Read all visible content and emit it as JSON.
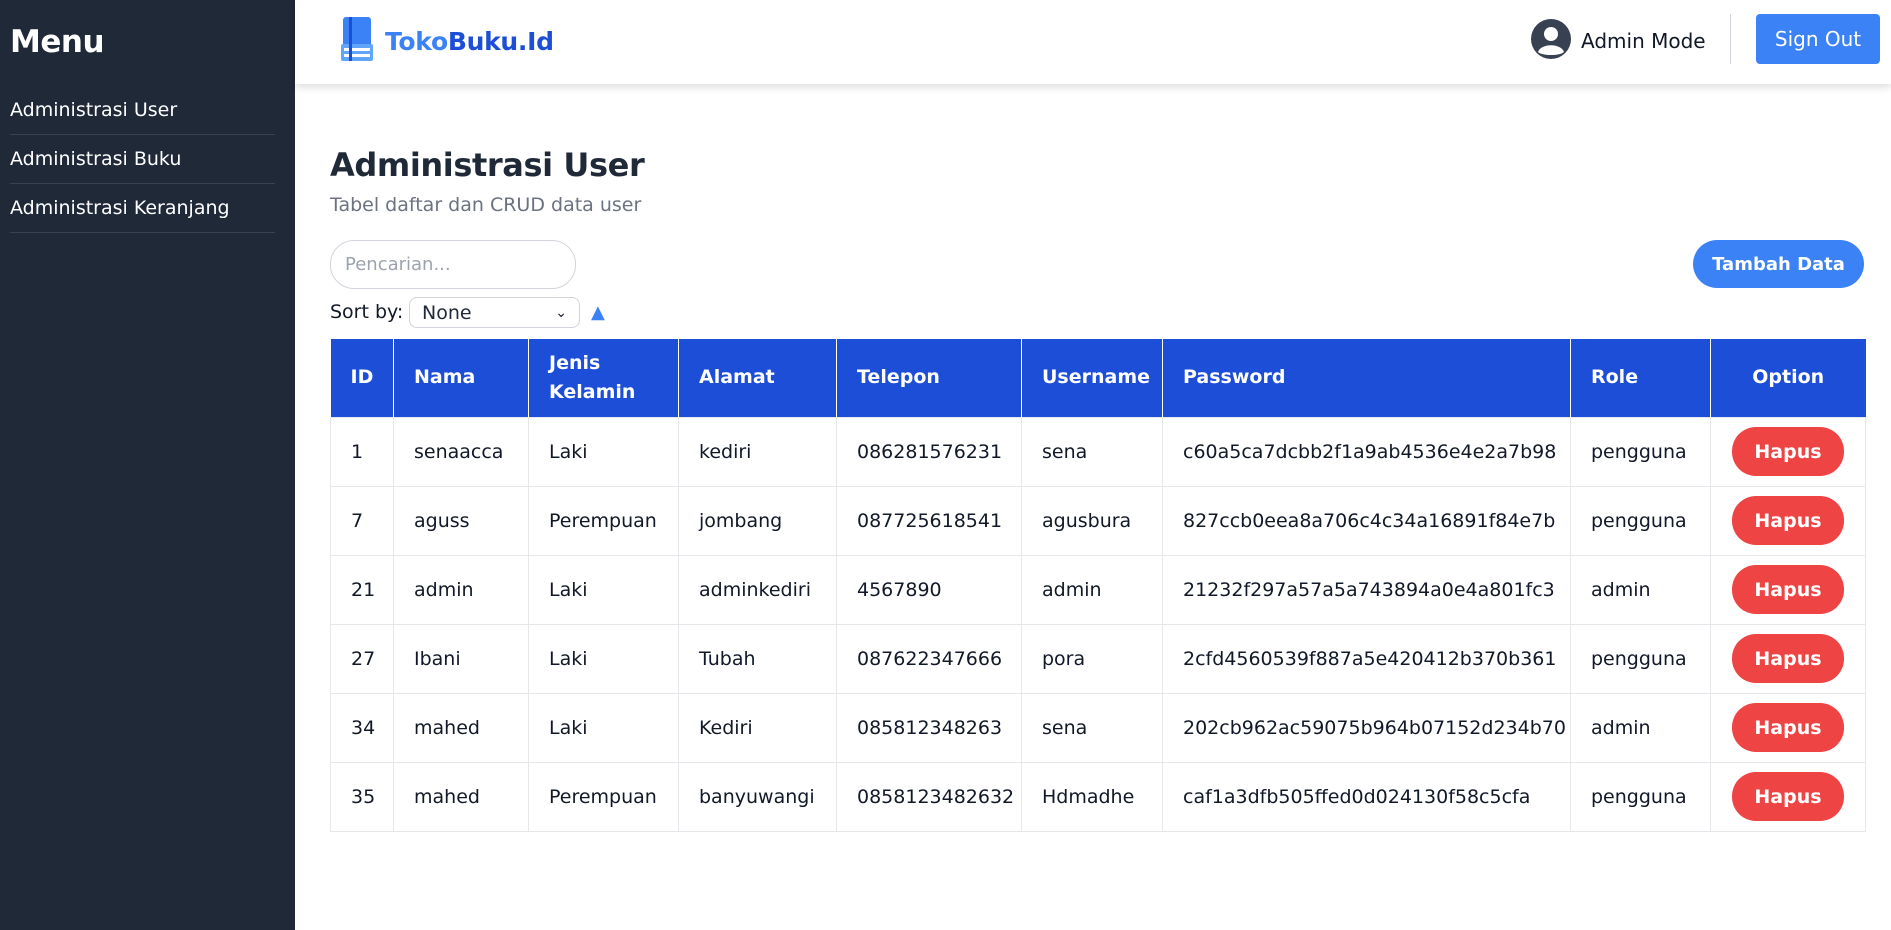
{
  "sidebar": {
    "title": "Menu",
    "items": [
      {
        "label": "Administrasi User"
      },
      {
        "label": "Administrasi Buku"
      },
      {
        "label": "Administrasi Keranjang"
      }
    ]
  },
  "header": {
    "brand_part1": "Toko",
    "brand_part2": "Buku.Id",
    "admin_mode": "Admin Mode",
    "sign_out": "Sign Out"
  },
  "main": {
    "title": "Administrasi User",
    "subtitle": "Tabel daftar dan CRUD data user",
    "search_placeholder": "Pencarian...",
    "add_button": "Tambah Data",
    "sort_label": "Sort by:",
    "sort_value": "None",
    "sort_direction_icon": "▲"
  },
  "table": {
    "headers": [
      "ID",
      "Nama",
      "Jenis Kelamin",
      "Alamat",
      "Telepon",
      "Username",
      "Password",
      "Role",
      "Option"
    ],
    "rows": [
      [
        "1",
        "senaacca",
        "Laki",
        "kediri",
        "086281576231",
        "sena",
        "c60a5ca7dcbb2f1a9ab4536e4e2a7b98",
        "pengguna"
      ],
      [
        "7",
        "aguss",
        "Perempuan",
        "jombang",
        "087725618541",
        "agusbura",
        "827ccb0eea8a706c4c34a16891f84e7b",
        "pengguna"
      ],
      [
        "21",
        "admin",
        "Laki",
        "adminkediri",
        "4567890",
        "admin",
        "21232f297a57a5a743894a0e4a801fc3",
        "admin"
      ],
      [
        "27",
        "Ibani",
        "Laki",
        "Tubah",
        "087622347666",
        "pora",
        "2cfd4560539f887a5e420412b370b361",
        "pengguna"
      ],
      [
        "34",
        "mahed",
        "Laki",
        "Kediri",
        "085812348263",
        "sena",
        "202cb962ac59075b964b07152d234b70",
        "admin"
      ],
      [
        "35",
        "mahed",
        "Perempuan",
        "banyuwangi",
        "0858123482632",
        "Hdmadhe",
        "caf1a3dfb505ffed0d024130f58c5cfa",
        "pengguna"
      ]
    ],
    "delete_label": "Hapus"
  },
  "colors": {
    "sidebar_bg": "#1f2937",
    "primary": "#3b82f6",
    "table_header": "#1d4ed8",
    "danger": "#ef4444"
  }
}
